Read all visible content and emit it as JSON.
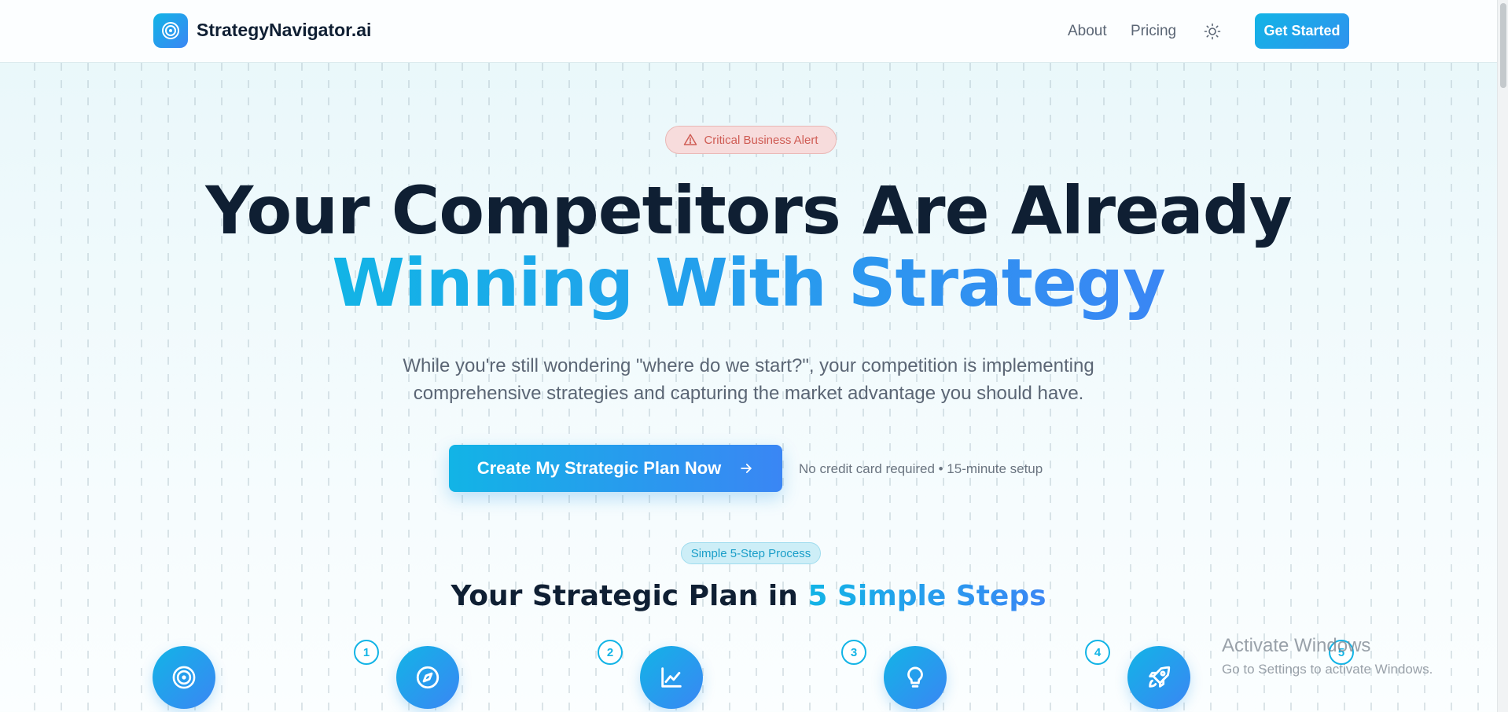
{
  "header": {
    "brand": "StrategyNavigator.ai",
    "logo_icon": "target-icon",
    "nav": [
      {
        "label": "About"
      },
      {
        "label": "Pricing"
      }
    ],
    "theme_icon": "sun-icon",
    "cta_label": "Get Started"
  },
  "hero": {
    "alert_label": "Critical Business Alert",
    "alert_icon": "warning-triangle-icon",
    "headline_line1": "Your Competitors Are Already",
    "headline_line2": "Winning With Strategy",
    "subtext_line1": "While you're still wondering \"where do we start?\", your competition is implementing",
    "subtext_line2": "comprehensive strategies and capturing the market advantage you should have.",
    "cta_label": "Create My Strategic Plan Now",
    "cta_icon": "arrow-right-icon",
    "cta_note": "No credit card required • 15-minute setup"
  },
  "process": {
    "badge": "Simple 5-Step Process",
    "title_prefix": "Your Strategic Plan in ",
    "title_highlight": "5 Simple Steps",
    "steps": [
      {
        "number": "1",
        "icon": "target-icon"
      },
      {
        "number": "2",
        "icon": "compass-icon"
      },
      {
        "number": "3",
        "icon": "chart-line-icon"
      },
      {
        "number": "4",
        "icon": "lightbulb-icon"
      },
      {
        "number": "5",
        "icon": "rocket-icon"
      }
    ]
  },
  "watermark": {
    "title": "Activate Windows",
    "subtitle": "Go to Settings to activate Windows."
  },
  "colors": {
    "accent_start": "#12b4e6",
    "accent_end": "#3a86f4",
    "alert_text": "#cf5c54",
    "heading": "#0f1f33"
  }
}
